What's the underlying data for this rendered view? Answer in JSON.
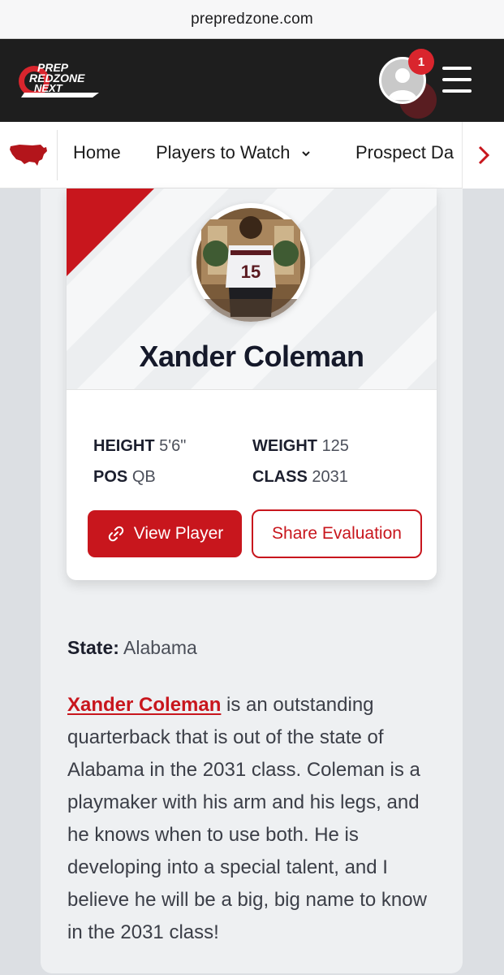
{
  "browser": {
    "url": "prepredzone.com"
  },
  "header": {
    "logo_lines": [
      "PREP",
      "REDZONE",
      "NEXT"
    ],
    "notification_count": "1"
  },
  "nav": {
    "items": [
      {
        "label": "Home"
      },
      {
        "label": "Players to Watch",
        "has_dropdown": true
      },
      {
        "label": "Prospect Da"
      }
    ]
  },
  "player": {
    "name": "Xander Coleman",
    "jersey_number": "15",
    "stats": {
      "height_label": "HEIGHT",
      "height": "5'6\"",
      "weight_label": "WEIGHT",
      "weight": "125",
      "pos_label": "POS",
      "pos": "QB",
      "class_label": "CLASS",
      "class": "2031"
    },
    "buttons": {
      "view": "View Player",
      "share": "Share Evaluation"
    }
  },
  "article": {
    "state_label": "State:",
    "state": "Alabama",
    "player_link": "Xander Coleman",
    "body": " is an outstanding quarterback that is out of the state of Alabama in the 2031 class. Coleman is a playmaker with his arm and his legs, and he knows when to use both. He is developing into a special talent, and I believe he will be a big, big name to know in the 2031 class!"
  },
  "colors": {
    "brand_red": "#c8161d",
    "header_bg": "#1e1e1e",
    "badge_red": "#d9252d"
  }
}
